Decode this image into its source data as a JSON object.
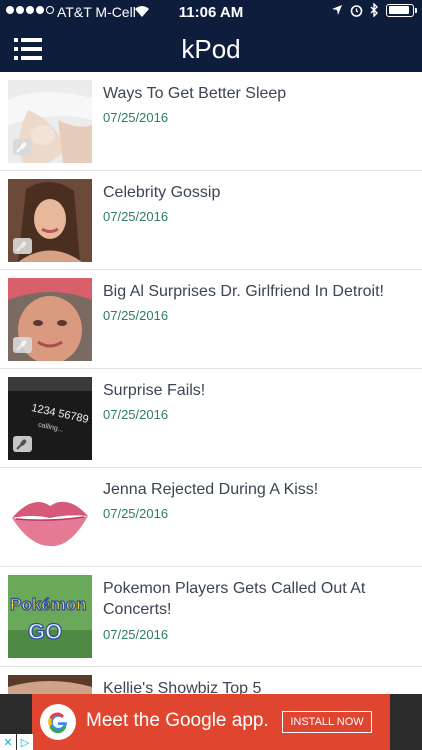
{
  "status_bar": {
    "carrier": "AT&T M-Cell",
    "time": "11:06 AM",
    "signal_bars_filled": 4,
    "signal_bars_total": 5,
    "battery_level": 0.9
  },
  "nav": {
    "title": "kPod",
    "background_color": "#0f1d3d",
    "menu_icon": "list-menu-icon"
  },
  "episodes": [
    {
      "title": "Ways To Get Better Sleep",
      "date": "07/25/2016"
    },
    {
      "title": "Celebrity Gossip",
      "date": "07/25/2016"
    },
    {
      "title": "Big Al Surprises Dr. Girlfriend In Detroit!",
      "date": "07/25/2016"
    },
    {
      "title": "Surprise Fails!",
      "date": "07/25/2016"
    },
    {
      "title": "Jenna Rejected During A Kiss!",
      "date": "07/25/2016"
    },
    {
      "title": "Pokemon Players Gets Called Out At Concerts!",
      "date": "07/25/2016"
    },
    {
      "title": "Kellie's Showbiz Top 5",
      "date": ""
    }
  ],
  "thumbnails": {
    "phone_number": "1234 56789",
    "phone_status": "calling...",
    "game_logo_top": "Pokémon",
    "game_logo_bottom": "GO"
  },
  "ad": {
    "text": "Meet the Google app.",
    "button": "INSTALL NOW",
    "logo_letter": "G",
    "accent_color": "#e0452f"
  },
  "colors": {
    "date_text": "#2e7d64",
    "title_text": "#3b4553"
  }
}
